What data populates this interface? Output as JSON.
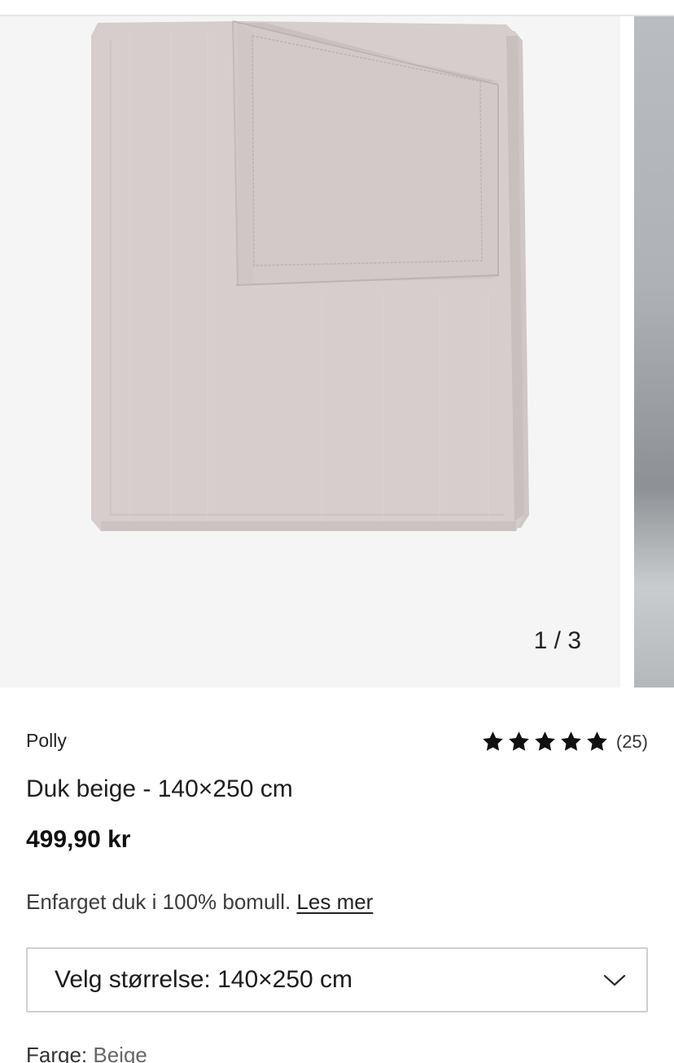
{
  "gallery": {
    "counter": "1 / 3"
  },
  "product": {
    "brand": "Polly",
    "rating": {
      "stars": 5,
      "max_stars": 5,
      "review_count": "(25)"
    },
    "title": "Duk beige - 140×250 cm",
    "price": "499,90 kr",
    "description": "Enfarget duk i 100% bomull.",
    "read_more_label": "Les mer",
    "size_select": {
      "label": "Velg størrelse: 140×250 cm"
    },
    "color": {
      "label": "Farge:",
      "value": "Beige"
    }
  },
  "icons": {
    "star": "star-icon",
    "chevron": "chevron-down-icon"
  },
  "colors": {
    "fabric": "#d4cbcb",
    "image_background": "#f5f5f5",
    "star": "#111111"
  }
}
